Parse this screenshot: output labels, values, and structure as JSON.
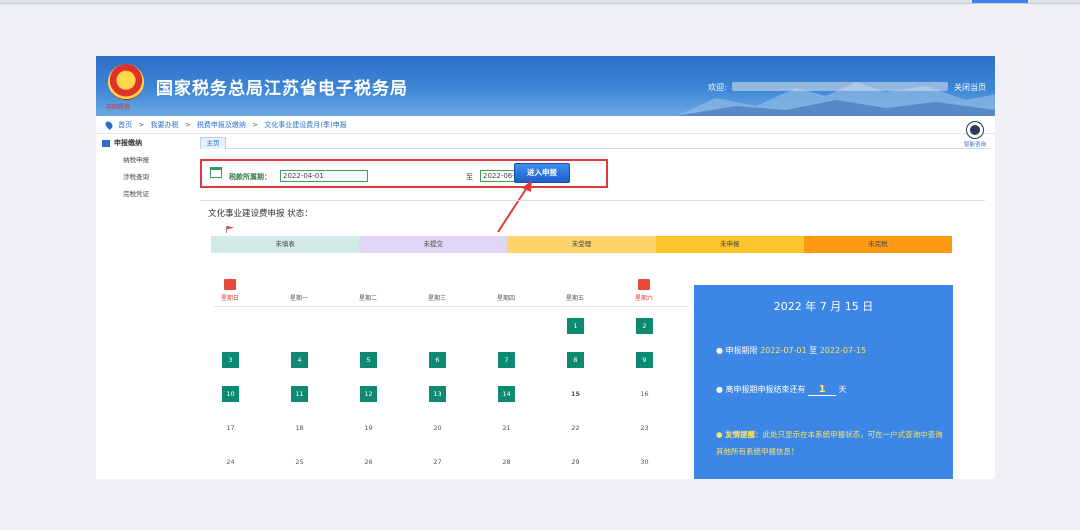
{
  "header": {
    "emblem_text": "中国税务",
    "site_title": "国家税务总局江苏省电子税务局",
    "welcome_label": "欢迎:",
    "close_label": "关闭当页"
  },
  "breadcrumb": [
    "首页",
    "我要办税",
    "税费申报及缴纳",
    "文化事业建设费月(季)申报"
  ],
  "breadcrumb_sep": ">",
  "assistant": {
    "label": "智能咨询"
  },
  "sidebar": {
    "title": "申报缴纳",
    "items": [
      "纳税申报",
      "涉税查询",
      "完税凭证"
    ]
  },
  "tabs": {
    "home": "主页"
  },
  "filter": {
    "label": "税款所属期：",
    "start": "2022-04-01",
    "to": "至",
    "end": "2022-06-30",
    "button": "进入申报"
  },
  "status": {
    "title": "文化事业建设费申报 状态：",
    "segments": [
      {
        "label": "未填表",
        "color": "#d3ebe8"
      },
      {
        "label": "未提交",
        "color": "#e2d6f7"
      },
      {
        "label": "未受理",
        "color": "#fdd469"
      },
      {
        "label": "未申报",
        "color": "#fec42c"
      },
      {
        "label": "未完税",
        "color": "#fe9b12"
      }
    ]
  },
  "calendar": {
    "weekdays": [
      "星期日",
      "星期一",
      "星期二",
      "星期三",
      "星期四",
      "星期五",
      "星期六"
    ],
    "weeks": [
      [
        "",
        "",
        "",
        "",
        "",
        "1",
        "2"
      ],
      [
        "3",
        "4",
        "5",
        "6",
        "7",
        "8",
        "9"
      ],
      [
        "10",
        "11",
        "12",
        "13",
        "14",
        "15",
        "16"
      ],
      [
        "17",
        "18",
        "19",
        "20",
        "21",
        "22",
        "23"
      ],
      [
        "24",
        "25",
        "26",
        "27",
        "28",
        "29",
        "30"
      ]
    ],
    "filled_days": [
      "1",
      "2",
      "3",
      "4",
      "5",
      "6",
      "7",
      "8",
      "9",
      "10",
      "11",
      "12",
      "13",
      "14"
    ],
    "today": "15"
  },
  "info": {
    "date": "2022 年 7 月 15 日",
    "period_label": "● 申报期限",
    "period_start": "2022-07-01",
    "period_to": "至",
    "period_end": "2022-07-15",
    "remain_prefix": "● 离申报期申报结束还有",
    "remain_days": "1",
    "remain_suffix": "天",
    "tip_label": "● 友情提醒",
    "tip_text": "：此处只显示在本系统申报状态，可在一户式查询中查询其他所有系统申报信息！"
  }
}
